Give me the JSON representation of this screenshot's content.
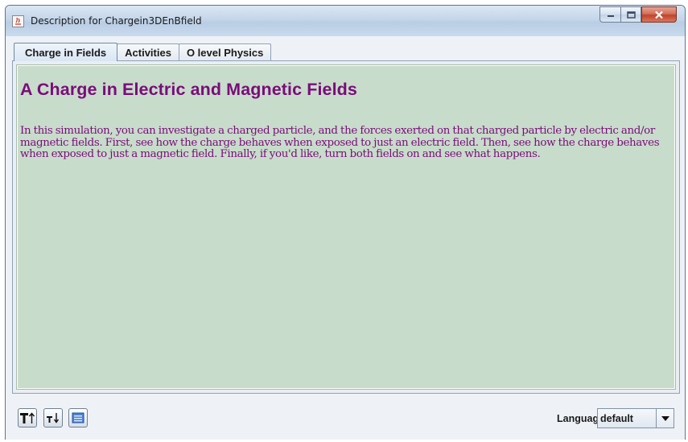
{
  "window": {
    "title": "Description for Chargein3DEnBfield"
  },
  "tabs": [
    {
      "label": "Charge in Fields",
      "active": true
    },
    {
      "label": "Activities",
      "active": false
    },
    {
      "label": "O level Physics",
      "active": false
    }
  ],
  "content": {
    "heading": "A Charge in Electric and Magnetic Fields",
    "body": "In this simulation, you can investigate a charged particle, and the forces exerted on that charged particle by electric and/or magnetic fields. First, see how the charge behaves when exposed to just an electric field. Then, see how the charge behaves when exposed to just a magnetic field. Finally, if you'd like, turn both fields on and see what happens.",
    "background_color": "#c8dccb",
    "text_color": "#7a0c7a"
  },
  "toolbar": {
    "buttons": [
      {
        "icon": "increase-font-icon"
      },
      {
        "icon": "decrease-font-icon"
      },
      {
        "icon": "window-icon"
      }
    ],
    "language_label": "Language:",
    "language_value": "default"
  }
}
